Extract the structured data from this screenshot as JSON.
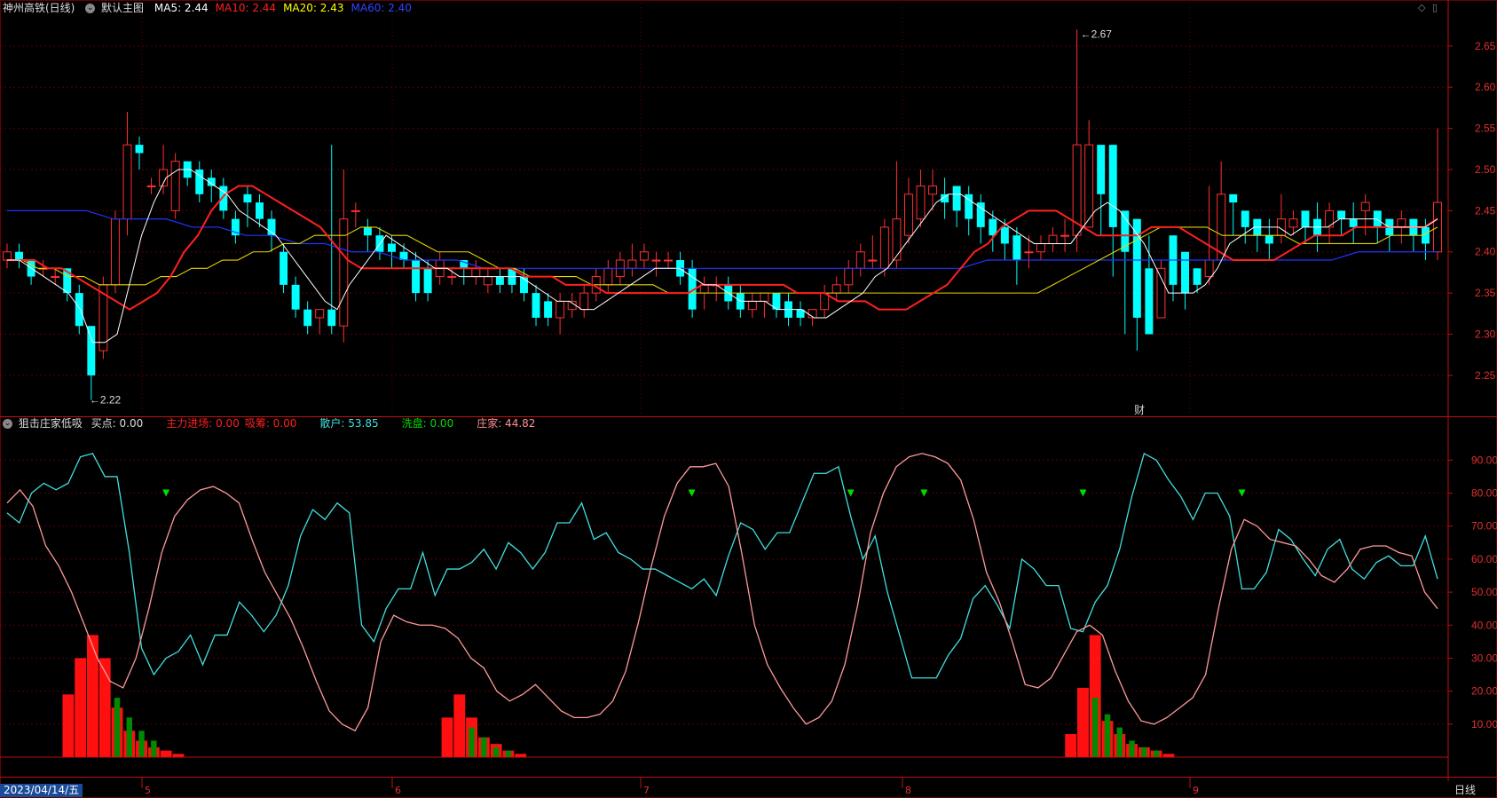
{
  "header": {
    "stock": "神州高铁(日线)",
    "main_chart": "默认主图",
    "ma": [
      {
        "label": "MA5: 2.44",
        "color": "#ffffff"
      },
      {
        "label": "MA10: 2.44",
        "color": "#ff2020"
      },
      {
        "label": "MA20: 2.43",
        "color": "#ffff00"
      },
      {
        "label": "MA60: 2.40",
        "color": "#3344ff"
      }
    ]
  },
  "indicator_header": {
    "name": "狙击庄家低吸",
    "items": [
      {
        "label": "买点: 0.00",
        "color": "#dddddd"
      },
      {
        "label": "主力进场: 0.00",
        "color": "#ff2020"
      },
      {
        "label": "吸筹: 0.00",
        "color": "#ff2020"
      },
      {
        "label": "散户: 53.85",
        "color": "#40e0e0"
      },
      {
        "label": "洗盘: 0.00",
        "color": "#00dd00"
      },
      {
        "label": "庄家: 44.82",
        "color": "#ff9090"
      }
    ]
  },
  "price_axis": [
    "2.65",
    "2.60",
    "2.55",
    "2.50",
    "2.45",
    "2.40",
    "2.35",
    "2.30",
    "2.25"
  ],
  "ind_axis": [
    "90.00",
    "80.00",
    "70.00",
    "60.00",
    "50.00",
    "40.00",
    "30.00",
    "20.00",
    "10.00"
  ],
  "annotations": {
    "high": "2.67",
    "low": "2.22",
    "marker": "财"
  },
  "status": {
    "date": "2023/04/14/五",
    "months": [
      "5",
      "6",
      "7",
      "8",
      "9"
    ],
    "period": "日线"
  },
  "colors": {
    "up": "#ff3030",
    "down": "#00ffff",
    "grid": "#5a0000",
    "axis": "#c01010",
    "bg": "#000000"
  },
  "chart_data": {
    "type": "candlestick",
    "open": [
      2.39,
      2.4,
      2.39,
      2.38,
      2.37,
      2.38,
      2.35,
      2.31,
      2.28,
      2.36,
      2.44,
      2.53,
      2.48,
      2.48,
      2.45,
      2.51,
      2.5,
      2.49,
      2.48,
      2.44,
      2.47,
      2.46,
      2.44,
      2.4,
      2.36,
      2.33,
      2.32,
      2.33,
      2.31,
      2.45,
      2.43,
      2.42,
      2.41,
      2.4,
      2.39,
      2.38,
      2.37,
      2.37,
      2.39,
      2.37,
      2.36,
      2.37,
      2.38,
      2.37,
      2.35,
      2.34,
      2.32,
      2.33,
      2.33,
      2.35,
      2.36,
      2.37,
      2.38,
      2.39,
      2.39,
      2.39,
      2.39,
      2.38,
      2.35,
      2.36,
      2.36,
      2.35,
      2.33,
      2.34,
      2.35,
      2.34,
      2.33,
      2.32,
      2.33,
      2.35,
      2.36,
      2.38,
      2.39,
      2.38,
      2.39,
      2.42,
      2.44,
      2.47,
      2.47,
      2.48,
      2.47,
      2.46,
      2.44,
      2.43,
      2.42,
      2.4,
      2.4,
      2.41,
      2.42,
      2.42,
      2.43,
      2.53,
      2.53,
      2.45,
      2.44,
      2.38,
      2.32,
      2.42,
      2.4,
      2.38,
      2.37,
      2.39,
      2.47,
      2.45,
      2.44,
      2.42,
      2.42,
      2.43,
      2.45,
      2.44,
      2.43,
      2.45,
      2.44,
      2.45,
      2.45,
      2.44,
      2.43,
      2.44,
      2.43,
      2.4
    ],
    "close": [
      2.4,
      2.39,
      2.37,
      2.38,
      2.37,
      2.35,
      2.31,
      2.25,
      2.36,
      2.44,
      2.53,
      2.52,
      2.48,
      2.5,
      2.51,
      2.49,
      2.47,
      2.48,
      2.45,
      2.42,
      2.46,
      2.44,
      2.42,
      2.36,
      2.33,
      2.31,
      2.33,
      2.31,
      2.44,
      2.45,
      2.42,
      2.4,
      2.4,
      2.39,
      2.35,
      2.35,
      2.39,
      2.37,
      2.38,
      2.38,
      2.37,
      2.36,
      2.36,
      2.35,
      2.32,
      2.32,
      2.34,
      2.34,
      2.35,
      2.37,
      2.38,
      2.39,
      2.39,
      2.4,
      2.39,
      2.39,
      2.37,
      2.33,
      2.36,
      2.36,
      2.34,
      2.33,
      2.34,
      2.35,
      2.33,
      2.32,
      2.32,
      2.33,
      2.35,
      2.36,
      2.38,
      2.4,
      2.39,
      2.43,
      2.44,
      2.47,
      2.48,
      2.48,
      2.46,
      2.45,
      2.44,
      2.43,
      2.42,
      2.41,
      2.39,
      2.4,
      2.41,
      2.42,
      2.42,
      2.53,
      2.53,
      2.47,
      2.43,
      2.4,
      2.32,
      2.3,
      2.38,
      2.36,
      2.35,
      2.36,
      2.39,
      2.47,
      2.46,
      2.43,
      2.42,
      2.41,
      2.44,
      2.44,
      2.43,
      2.42,
      2.45,
      2.44,
      2.43,
      2.46,
      2.43,
      2.42,
      2.44,
      2.42,
      2.41,
      2.46
    ],
    "high": [
      2.41,
      2.41,
      2.39,
      2.39,
      2.38,
      2.38,
      2.36,
      2.31,
      2.37,
      2.45,
      2.57,
      2.54,
      2.49,
      2.53,
      2.52,
      2.51,
      2.51,
      2.5,
      2.49,
      2.45,
      2.48,
      2.47,
      2.45,
      2.41,
      2.37,
      2.34,
      2.33,
      2.53,
      2.5,
      2.46,
      2.44,
      2.43,
      2.42,
      2.41,
      2.4,
      2.39,
      2.4,
      2.38,
      2.39,
      2.39,
      2.38,
      2.38,
      2.38,
      2.38,
      2.36,
      2.35,
      2.35,
      2.35,
      2.36,
      2.38,
      2.39,
      2.4,
      2.41,
      2.41,
      2.4,
      2.4,
      2.4,
      2.39,
      2.37,
      2.37,
      2.37,
      2.36,
      2.35,
      2.35,
      2.35,
      2.35,
      2.34,
      2.33,
      2.36,
      2.37,
      2.39,
      2.41,
      2.42,
      2.44,
      2.51,
      2.49,
      2.5,
      2.5,
      2.49,
      2.48,
      2.48,
      2.47,
      2.45,
      2.44,
      2.43,
      2.42,
      2.42,
      2.43,
      2.44,
      2.67,
      2.56,
      2.48,
      2.46,
      2.41,
      2.33,
      2.42,
      2.39,
      2.38,
      2.37,
      2.38,
      2.48,
      2.51,
      2.47,
      2.45,
      2.43,
      2.44,
      2.47,
      2.45,
      2.45,
      2.46,
      2.46,
      2.45,
      2.46,
      2.47,
      2.45,
      2.44,
      2.45,
      2.44,
      2.44,
      2.55
    ],
    "low": [
      2.38,
      2.38,
      2.36,
      2.37,
      2.36,
      2.34,
      2.3,
      2.22,
      2.27,
      2.35,
      2.42,
      2.5,
      2.47,
      2.47,
      2.44,
      2.48,
      2.46,
      2.46,
      2.44,
      2.41,
      2.43,
      2.43,
      2.4,
      2.35,
      2.32,
      2.3,
      2.3,
      2.3,
      2.29,
      2.43,
      2.4,
      2.39,
      2.38,
      2.38,
      2.34,
      2.34,
      2.36,
      2.36,
      2.36,
      2.36,
      2.35,
      2.35,
      2.35,
      2.34,
      2.31,
      2.31,
      2.3,
      2.32,
      2.32,
      2.34,
      2.35,
      2.36,
      2.37,
      2.38,
      2.37,
      2.38,
      2.36,
      2.32,
      2.33,
      2.34,
      2.33,
      2.32,
      2.32,
      2.32,
      2.32,
      2.31,
      2.31,
      2.31,
      2.32,
      2.34,
      2.35,
      2.37,
      2.38,
      2.37,
      2.38,
      2.41,
      2.43,
      2.45,
      2.44,
      2.43,
      2.42,
      2.41,
      2.4,
      2.39,
      2.36,
      2.38,
      2.39,
      2.4,
      2.4,
      2.4,
      2.46,
      2.42,
      2.37,
      2.3,
      2.28,
      2.34,
      2.35,
      2.34,
      2.33,
      2.35,
      2.36,
      2.44,
      2.42,
      2.41,
      2.4,
      2.39,
      2.41,
      2.42,
      2.41,
      2.4,
      2.41,
      2.42,
      2.41,
      2.42,
      2.41,
      2.4,
      2.41,
      2.4,
      2.39,
      2.39
    ],
    "ma5": [
      2.39,
      2.39,
      2.38,
      2.37,
      2.36,
      2.35,
      2.33,
      2.29,
      2.29,
      2.3,
      2.36,
      2.42,
      2.46,
      2.49,
      2.5,
      2.5,
      2.49,
      2.48,
      2.47,
      2.45,
      2.44,
      2.43,
      2.42,
      2.4,
      2.38,
      2.36,
      2.34,
      2.33,
      2.36,
      2.38,
      2.4,
      2.42,
      2.41,
      2.4,
      2.39,
      2.38,
      2.38,
      2.37,
      2.37,
      2.37,
      2.37,
      2.37,
      2.37,
      2.36,
      2.35,
      2.34,
      2.34,
      2.33,
      2.33,
      2.34,
      2.35,
      2.36,
      2.37,
      2.38,
      2.38,
      2.38,
      2.37,
      2.36,
      2.36,
      2.35,
      2.34,
      2.34,
      2.34,
      2.33,
      2.33,
      2.33,
      2.32,
      2.32,
      2.33,
      2.34,
      2.35,
      2.37,
      2.38,
      2.4,
      2.42,
      2.44,
      2.46,
      2.47,
      2.47,
      2.46,
      2.45,
      2.44,
      2.43,
      2.42,
      2.41,
      2.41,
      2.41,
      2.41,
      2.43,
      2.45,
      2.46,
      2.45,
      2.43,
      2.41,
      2.38,
      2.35,
      2.35,
      2.35,
      2.36,
      2.38,
      2.41,
      2.42,
      2.43,
      2.43,
      2.43,
      2.42,
      2.43,
      2.43,
      2.43,
      2.44,
      2.44,
      2.44,
      2.44,
      2.43,
      2.43,
      2.43,
      2.43,
      2.44
    ],
    "ma10": [
      2.39,
      2.39,
      2.39,
      2.38,
      2.38,
      2.37,
      2.36,
      2.35,
      2.34,
      2.33,
      2.34,
      2.35,
      2.37,
      2.4,
      2.42,
      2.45,
      2.47,
      2.48,
      2.48,
      2.47,
      2.46,
      2.45,
      2.44,
      2.43,
      2.41,
      2.39,
      2.38,
      2.38,
      2.38,
      2.38,
      2.38,
      2.38,
      2.38,
      2.38,
      2.38,
      2.38,
      2.38,
      2.38,
      2.37,
      2.37,
      2.37,
      2.36,
      2.36,
      2.36,
      2.35,
      2.35,
      2.35,
      2.35,
      2.35,
      2.35,
      2.35,
      2.36,
      2.36,
      2.36,
      2.36,
      2.36,
      2.36,
      2.36,
      2.35,
      2.35,
      2.35,
      2.34,
      2.34,
      2.34,
      2.33,
      2.33,
      2.33,
      2.34,
      2.35,
      2.36,
      2.38,
      2.4,
      2.41,
      2.43,
      2.44,
      2.45,
      2.45,
      2.45,
      2.44,
      2.43,
      2.42,
      2.42,
      2.42,
      2.42,
      2.43,
      2.43,
      2.43,
      2.42,
      2.41,
      2.4,
      2.39,
      2.39,
      2.39,
      2.39,
      2.4,
      2.41,
      2.42,
      2.42,
      2.42,
      2.43,
      2.43,
      2.43,
      2.43,
      2.43,
      2.43,
      2.44
    ],
    "ma20": [
      2.39,
      2.39,
      2.38,
      2.38,
      2.37,
      2.37,
      2.36,
      2.36,
      2.36,
      2.36,
      2.37,
      2.37,
      2.38,
      2.38,
      2.39,
      2.39,
      2.4,
      2.4,
      2.41,
      2.41,
      2.42,
      2.42,
      2.42,
      2.43,
      2.43,
      2.42,
      2.42,
      2.41,
      2.4,
      2.4,
      2.4,
      2.39,
      2.38,
      2.38,
      2.37,
      2.37,
      2.37,
      2.37,
      2.36,
      2.36,
      2.36,
      2.36,
      2.36,
      2.35,
      2.35,
      2.35,
      2.35,
      2.35,
      2.35,
      2.35,
      2.35,
      2.35,
      2.35,
      2.35,
      2.35,
      2.35,
      2.35,
      2.35,
      2.35,
      2.35,
      2.35,
      2.35,
      2.35,
      2.35,
      2.35,
      2.35,
      2.35,
      2.35,
      2.36,
      2.37,
      2.38,
      2.39,
      2.4,
      2.41,
      2.42,
      2.43,
      2.43,
      2.43,
      2.43,
      2.42,
      2.42,
      2.42,
      2.42,
      2.42,
      2.41,
      2.41,
      2.41,
      2.41,
      2.41,
      2.41,
      2.42,
      2.42,
      2.42,
      2.43
    ],
    "ma60": [
      2.45,
      2.45,
      2.45,
      2.45,
      2.44,
      2.44,
      2.44,
      2.43,
      2.43,
      2.42,
      2.42,
      2.41,
      2.41,
      2.4,
      2.4,
      2.39,
      2.39,
      2.39,
      2.38,
      2.38,
      2.38,
      2.38,
      2.38,
      2.38,
      2.38,
      2.38,
      2.38,
      2.38,
      2.38,
      2.38,
      2.38,
      2.38,
      2.38,
      2.38,
      2.38,
      2.38,
      2.38,
      2.39,
      2.39,
      2.39,
      2.39,
      2.39,
      2.39,
      2.39,
      2.39,
      2.39,
      2.39,
      2.39,
      2.39,
      2.39,
      2.39,
      2.4,
      2.4,
      2.4,
      2.4
    ],
    "sanhu": [
      74,
      71,
      80,
      83,
      81,
      83,
      91,
      92,
      85,
      85,
      62,
      33,
      25,
      30,
      32,
      37,
      28,
      37,
      37,
      47,
      43,
      38,
      43,
      52,
      67,
      75,
      72,
      77,
      74,
      40,
      35,
      45,
      51,
      51,
      62,
      49,
      57,
      57,
      59,
      63,
      57,
      65,
      62,
      57,
      62,
      71,
      71,
      77,
      66,
      68,
      62,
      60,
      57,
      57,
      55,
      53,
      51,
      54,
      49,
      61,
      71,
      69,
      63,
      68,
      68,
      77,
      86,
      86,
      88,
      73,
      60,
      67,
      50,
      37,
      24,
      24,
      24,
      31,
      36,
      48,
      52,
      46,
      39,
      60,
      57,
      52,
      52,
      39,
      38,
      47,
      52,
      63,
      79,
      92,
      90,
      84,
      79,
      72,
      80,
      80,
      73,
      51,
      51,
      56,
      69,
      66,
      60,
      55,
      63,
      66,
      57,
      54,
      59,
      61,
      58,
      58,
      67,
      54
    ],
    "zhuangjia": [
      77,
      81,
      76,
      64,
      58,
      50,
      40,
      30,
      23,
      21,
      30,
      45,
      62,
      73,
      78,
      81,
      82,
      80,
      77,
      66,
      56,
      49,
      42,
      33,
      23,
      14,
      10,
      8,
      15,
      35,
      43,
      41,
      40,
      40,
      39,
      36,
      30,
      27,
      20,
      17,
      19,
      22,
      18,
      14,
      12,
      12,
      13,
      17,
      26,
      41,
      58,
      73,
      83,
      88,
      88,
      89,
      82,
      62,
      40,
      28,
      21,
      15,
      10,
      12,
      17,
      28,
      46,
      68,
      80,
      88,
      91,
      92,
      91,
      89,
      84,
      72,
      56,
      47,
      35,
      22,
      21,
      24,
      31,
      38,
      40,
      37,
      26,
      17,
      11,
      10,
      12,
      15,
      18,
      25,
      45,
      63,
      72,
      70,
      66,
      65,
      64,
      60,
      55,
      53,
      57,
      63,
      64,
      64,
      62,
      61,
      50,
      45
    ],
    "buy_signal_idx": [
      13,
      56,
      69,
      75,
      88,
      101
    ],
    "red_bars": [
      [
        5,
        19
      ],
      [
        6,
        30
      ],
      [
        7,
        37
      ],
      [
        8,
        30
      ],
      [
        9,
        15
      ],
      [
        10,
        8
      ],
      [
        11,
        5
      ],
      [
        12,
        3
      ],
      [
        13,
        2
      ],
      [
        14,
        1
      ],
      [
        36,
        12
      ],
      [
        37,
        19
      ],
      [
        38,
        12
      ],
      [
        39,
        6
      ],
      [
        40,
        4
      ],
      [
        41,
        2
      ],
      [
        42,
        1
      ],
      [
        87,
        7
      ],
      [
        88,
        21
      ],
      [
        89,
        37
      ],
      [
        90,
        11
      ],
      [
        91,
        7
      ],
      [
        92,
        4
      ],
      [
        93,
        3
      ],
      [
        94,
        2
      ],
      [
        95,
        1
      ]
    ],
    "green_bars": [
      [
        9,
        18
      ],
      [
        10,
        12
      ],
      [
        11,
        8
      ],
      [
        12,
        5
      ],
      [
        38,
        9
      ],
      [
        39,
        6
      ],
      [
        40,
        3
      ],
      [
        41,
        2
      ],
      [
        89,
        18
      ],
      [
        90,
        13
      ],
      [
        91,
        9
      ],
      [
        92,
        5
      ],
      [
        93,
        3
      ],
      [
        94,
        2
      ]
    ]
  }
}
